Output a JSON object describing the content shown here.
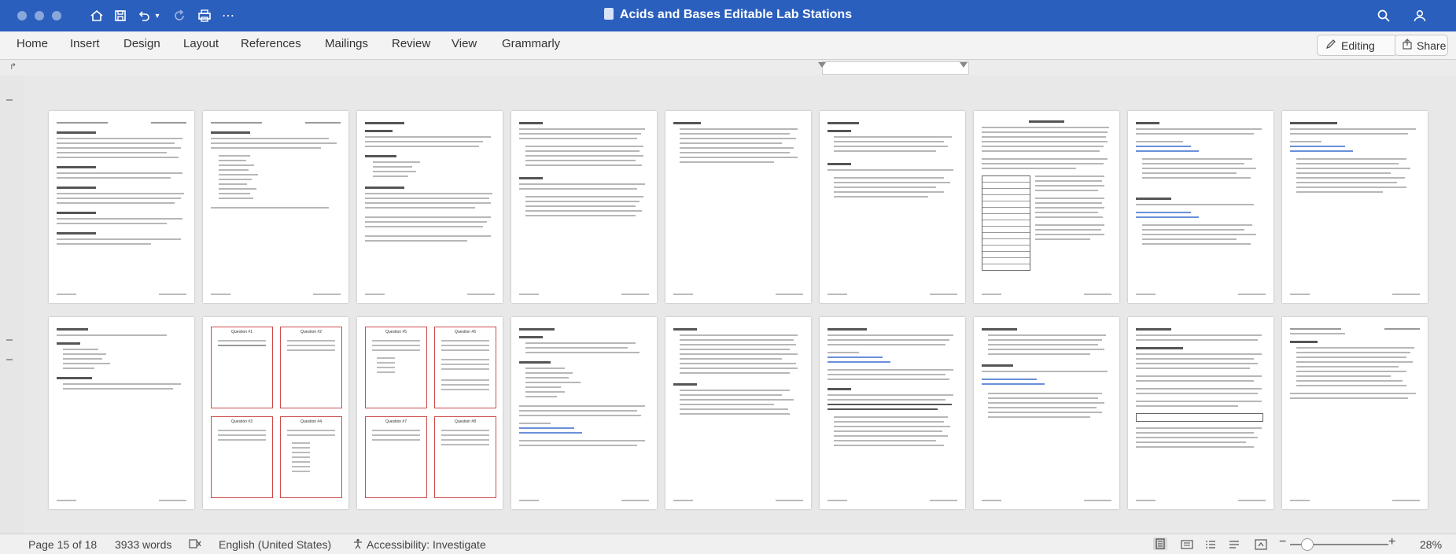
{
  "window": {
    "title": "Acids and Bases Editable Lab Stations"
  },
  "quick_access": {
    "icons": [
      "home-icon",
      "save-icon",
      "undo-icon",
      "redo-icon",
      "print-icon",
      "more-icon"
    ]
  },
  "ribbon": {
    "tabs": [
      "Home",
      "Insert",
      "Design",
      "Layout",
      "References",
      "Mailings",
      "Review",
      "View",
      "Grammarly"
    ],
    "editing_label": "Editing",
    "share_label": "Share"
  },
  "status": {
    "page": "Page 15 of 18",
    "words": "3933 words",
    "language": "English (United States)",
    "accessibility": "Accessibility: Investigate",
    "zoom": "28%"
  },
  "thumbnail_text": {
    "question_cards": [
      "Question #1",
      "Question #2",
      "Question #3",
      "Question #4",
      "Question #5",
      "Question #6",
      "Question #7",
      "Question #8"
    ]
  },
  "colors": {
    "titlebar": "#2b5fbd",
    "card_border": "#cf4a4a"
  }
}
